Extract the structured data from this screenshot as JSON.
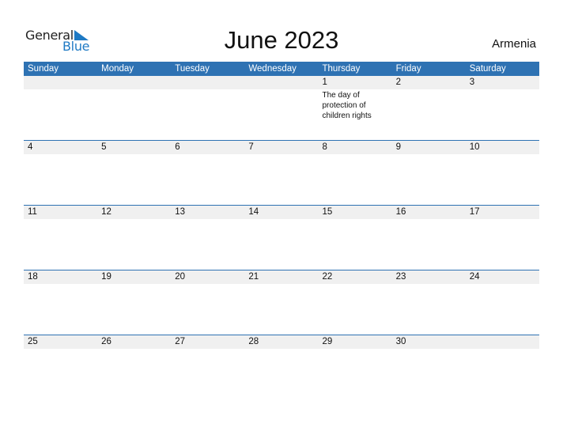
{
  "logo": {
    "line1": "General",
    "line2": "Blue"
  },
  "title": "June 2023",
  "country": "Armenia",
  "weekdays": [
    "Sunday",
    "Monday",
    "Tuesday",
    "Wednesday",
    "Thursday",
    "Friday",
    "Saturday"
  ],
  "weeks": [
    {
      "days": [
        "",
        "",
        "",
        "",
        "1",
        "2",
        "3"
      ],
      "events": [
        "",
        "",
        "",
        "",
        "The day of protection of children rights",
        "",
        ""
      ]
    },
    {
      "days": [
        "4",
        "5",
        "6",
        "7",
        "8",
        "9",
        "10"
      ],
      "events": [
        "",
        "",
        "",
        "",
        "",
        "",
        ""
      ]
    },
    {
      "days": [
        "11",
        "12",
        "13",
        "14",
        "15",
        "16",
        "17"
      ],
      "events": [
        "",
        "",
        "",
        "",
        "",
        "",
        ""
      ]
    },
    {
      "days": [
        "18",
        "19",
        "20",
        "21",
        "22",
        "23",
        "24"
      ],
      "events": [
        "",
        "",
        "",
        "",
        "",
        "",
        ""
      ]
    },
    {
      "days": [
        "25",
        "26",
        "27",
        "28",
        "29",
        "30",
        ""
      ],
      "events": [
        "",
        "",
        "",
        "",
        "",
        "",
        ""
      ]
    }
  ],
  "colors": {
    "accent": "#2e72b3",
    "logo_blue": "#1f7ac4",
    "date_strip": "#f0f0f0"
  }
}
